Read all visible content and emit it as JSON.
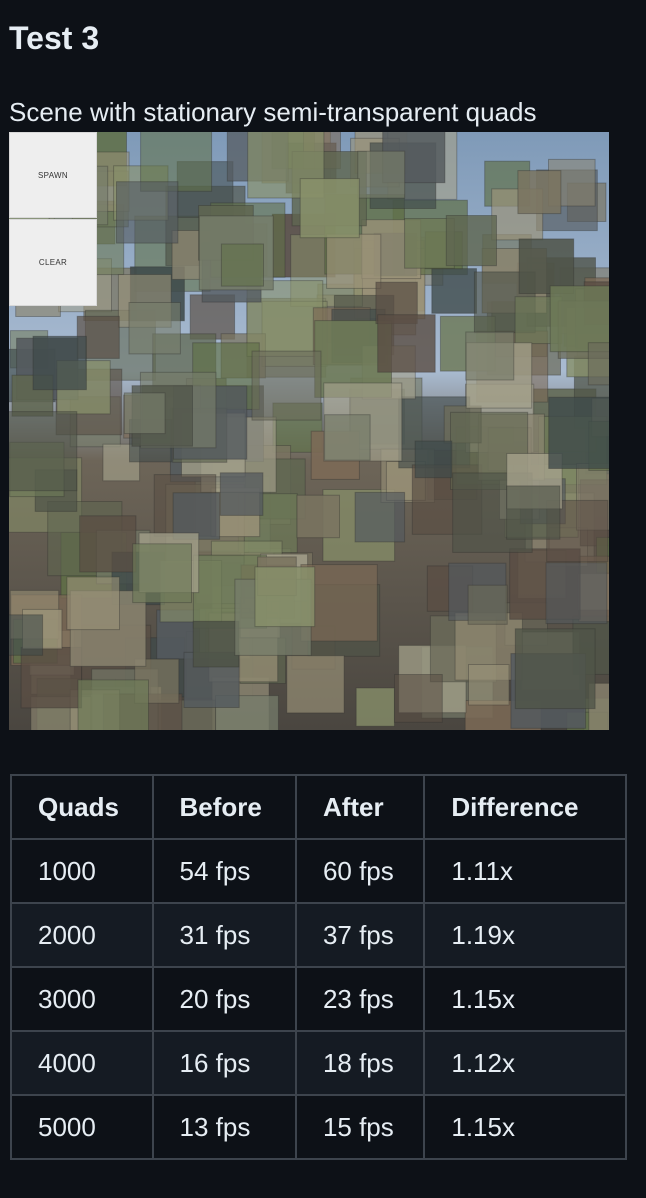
{
  "heading": "Test 3",
  "caption": "Scene with stationary semi-transparent quads",
  "scene": {
    "buttons": {
      "spawn": "SPAWN",
      "clear": "CLEAR"
    },
    "palette": [
      "#6b6b5a",
      "#7a7460",
      "#5f6650",
      "#8a8470",
      "#4f5448",
      "#6e7a58",
      "#9a9278",
      "#545a5e",
      "#767c6a",
      "#5a4e44",
      "#88906a",
      "#3f4a4a",
      "#a3a08a",
      "#607048",
      "#7c6a56"
    ]
  },
  "table": {
    "headers": [
      "Quads",
      "Before",
      "After",
      "Difference"
    ],
    "rows": [
      [
        "1000",
        "54 fps",
        "60 fps",
        "1.11x"
      ],
      [
        "2000",
        "31 fps",
        "37 fps",
        "1.19x"
      ],
      [
        "3000",
        "20 fps",
        "23 fps",
        "1.15x"
      ],
      [
        "4000",
        "16 fps",
        "18 fps",
        "1.12x"
      ],
      [
        "5000",
        "13 fps",
        "15 fps",
        "1.15x"
      ]
    ]
  }
}
